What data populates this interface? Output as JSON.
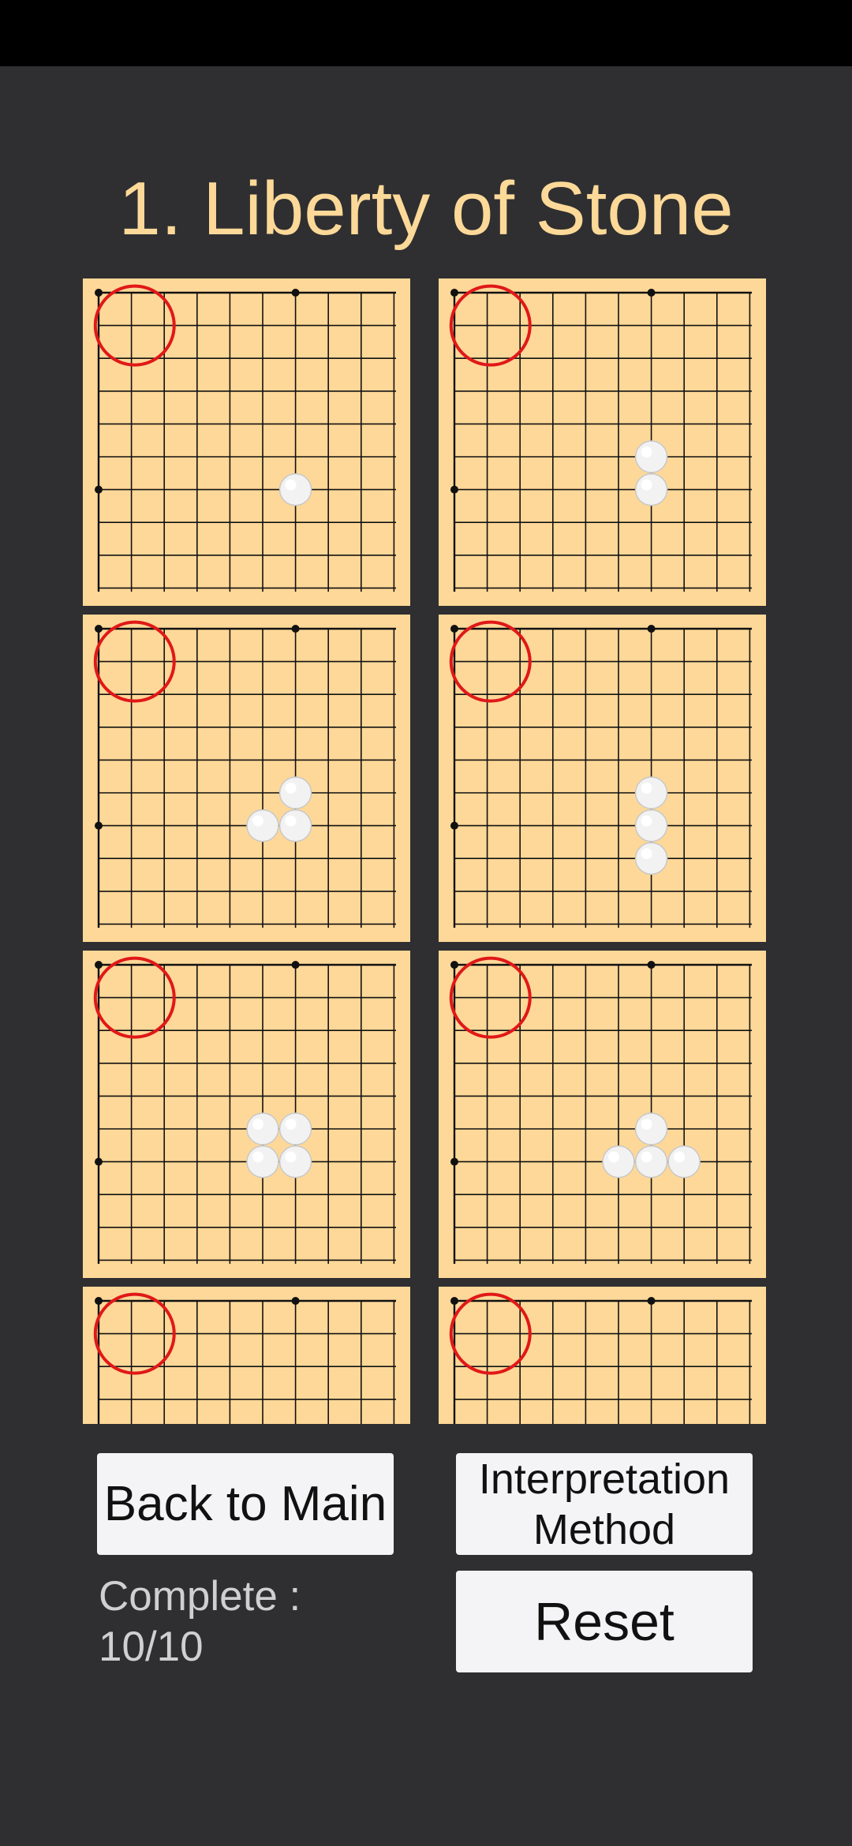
{
  "title": "1. Liberty of Stone",
  "colors": {
    "background": "#2f2f31",
    "title": "#fcd998",
    "board": "#fed898",
    "grid_line": "#111111",
    "marker_circle": "#e01818",
    "stone_white": "#f2f2f2"
  },
  "boards": [
    {
      "id": 1,
      "stones": [
        [
          6,
          6
        ]
      ]
    },
    {
      "id": 2,
      "stones": [
        [
          6,
          5
        ],
        [
          6,
          6
        ]
      ]
    },
    {
      "id": 3,
      "stones": [
        [
          6,
          5
        ],
        [
          5,
          6
        ],
        [
          6,
          6
        ]
      ]
    },
    {
      "id": 4,
      "stones": [
        [
          6,
          5
        ],
        [
          6,
          6
        ],
        [
          6,
          7
        ]
      ]
    },
    {
      "id": 5,
      "stones": [
        [
          5,
          5
        ],
        [
          6,
          5
        ],
        [
          5,
          6
        ],
        [
          6,
          6
        ]
      ]
    },
    {
      "id": 6,
      "stones": [
        [
          6,
          5
        ],
        [
          5,
          6
        ],
        [
          6,
          6
        ],
        [
          7,
          6
        ]
      ]
    },
    {
      "id": 7,
      "stones": []
    },
    {
      "id": 8,
      "stones": []
    }
  ],
  "board_icon": "marker-circle-icon",
  "buttons": {
    "back": "Back to Main",
    "interpretation_line1": "Interpretation",
    "interpretation_line2": "Method",
    "reset": "Reset"
  },
  "status": {
    "complete_label": "Complete :",
    "complete_value": "10/10"
  }
}
